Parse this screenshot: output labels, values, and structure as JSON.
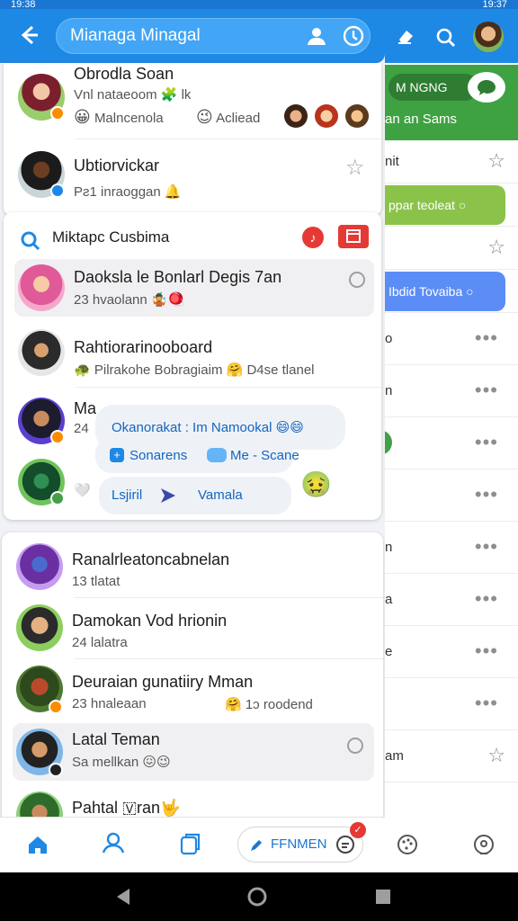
{
  "status_bar": {
    "time": "19:38",
    "right": "19:37"
  },
  "header": {
    "title": "Mianaga Minagal"
  },
  "background_panel": {
    "card_label": "M NGNG",
    "card_subtitle": "an an Sams",
    "rows": [
      {
        "text": "nit",
        "action": "star"
      },
      {
        "text": "ppar teoleat",
        "pill": "green"
      },
      {
        "text": "",
        "action": "star"
      },
      {
        "text": "Ibdid Tovaiba",
        "pill": "blue"
      },
      {
        "text": "o",
        "action": "more"
      },
      {
        "text": "n",
        "action": "more"
      },
      {
        "text": "",
        "action": "more"
      },
      {
        "text": "",
        "action": "more"
      },
      {
        "text": "n",
        "action": "more"
      },
      {
        "text": "a",
        "action": "more"
      },
      {
        "text": "e",
        "action": "more"
      },
      {
        "text": "",
        "action": "more"
      },
      {
        "text": "am",
        "action": "star"
      }
    ],
    "more_label": "•••",
    "star_label": "☆"
  },
  "top_card": {
    "rows": [
      {
        "name": "Obrodla Soan",
        "sub": "Vnl nataeoom 🧩 lk",
        "reactions": [
          {
            "emoji": "😀",
            "label": "Malncenola"
          },
          {
            "emoji": "😉",
            "label": "Acliead"
          }
        ]
      },
      {
        "name": "Ubtiorvickar",
        "sub": "Pƨ1 inraoggan 🔔"
      }
    ]
  },
  "search_card": {
    "title": "Miktapc Cusbima",
    "rows": [
      {
        "name": "Daoksla le Bonlarl Degis 7an",
        "sub": "23 hvaolann 🤹🪀"
      },
      {
        "name": "Rahtiorarinooboard",
        "sub": "Pilrakohe Bobragiaim 🤗 D4se tlanel",
        "sub_prefix": "🐢"
      },
      {
        "name": "Ma",
        "sub": "24"
      },
      {
        "name": "",
        "sub": "🤍"
      }
    ],
    "popup": {
      "line1": "Okanorakat : Im Namookal 😄😄",
      "line1_highlight": "Im",
      "line2_a": "Sonarens",
      "line2_b": "Me - Scane",
      "line3_a": "Lsjiril",
      "line3_b": "Vamala",
      "emoji": "🤢"
    }
  },
  "list_card": {
    "rows": [
      {
        "name": "Ranalrleatoncabnelan",
        "sub": "13 tlatat"
      },
      {
        "name": "Damokan Vod hrionin",
        "sub": "24 lalatra"
      },
      {
        "name": "Deuraian gunatiiry Mman",
        "sub": "23 hnaleaan",
        "extra": "🤗 1ↄ roodend"
      },
      {
        "name": "Latal Teman",
        "sub": "Sa mellkan 😖😉"
      },
      {
        "name": "Pahtal 🇻ran🤟",
        "sub": ""
      }
    ]
  },
  "bottom_nav": {
    "compose_label": "FFNMEN",
    "badge": "✓"
  },
  "colors": {
    "primary": "#1e88e5",
    "green": "#43a047",
    "blue_pill": "#5c8df6",
    "light_green_pill": "#8bc34a",
    "red": "#e53935"
  }
}
